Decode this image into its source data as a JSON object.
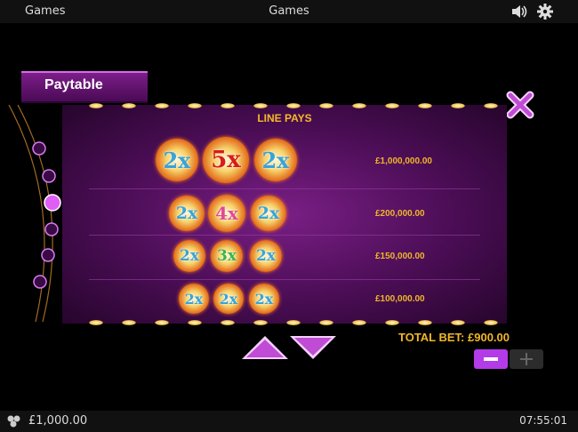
{
  "topbar": {
    "left_label": "Games",
    "center_label": "Games",
    "sound_icon": "speaker-icon",
    "settings_icon": "gear-icon"
  },
  "paytable": {
    "tab_label": "Paytable",
    "header": "LINE PAYS",
    "rows": [
      {
        "symbols": [
          "2x",
          "5x",
          "2x"
        ],
        "pay": "£1,000,000.00"
      },
      {
        "symbols": [
          "2x",
          "4x",
          "2x"
        ],
        "pay": "£200,000.00"
      },
      {
        "symbols": [
          "2x",
          "3x",
          "2x"
        ],
        "pay": "£150,000.00"
      },
      {
        "symbols": [
          "2x",
          "2x",
          "2x"
        ],
        "pay": "£100,000.00"
      }
    ],
    "page_count": 6,
    "active_page": 3
  },
  "bet": {
    "total_bet_label": "TOTAL BET: £900.00",
    "minus_icon": "minus-icon",
    "plus_icon": "plus-icon"
  },
  "bottombar": {
    "balance": "£1,000.00",
    "clock": "07:55:01",
    "chips_icon": "chips-icon"
  },
  "colors": {
    "accent": "#b43be8",
    "gold": "#f0b629",
    "panel": "#5a1366"
  }
}
